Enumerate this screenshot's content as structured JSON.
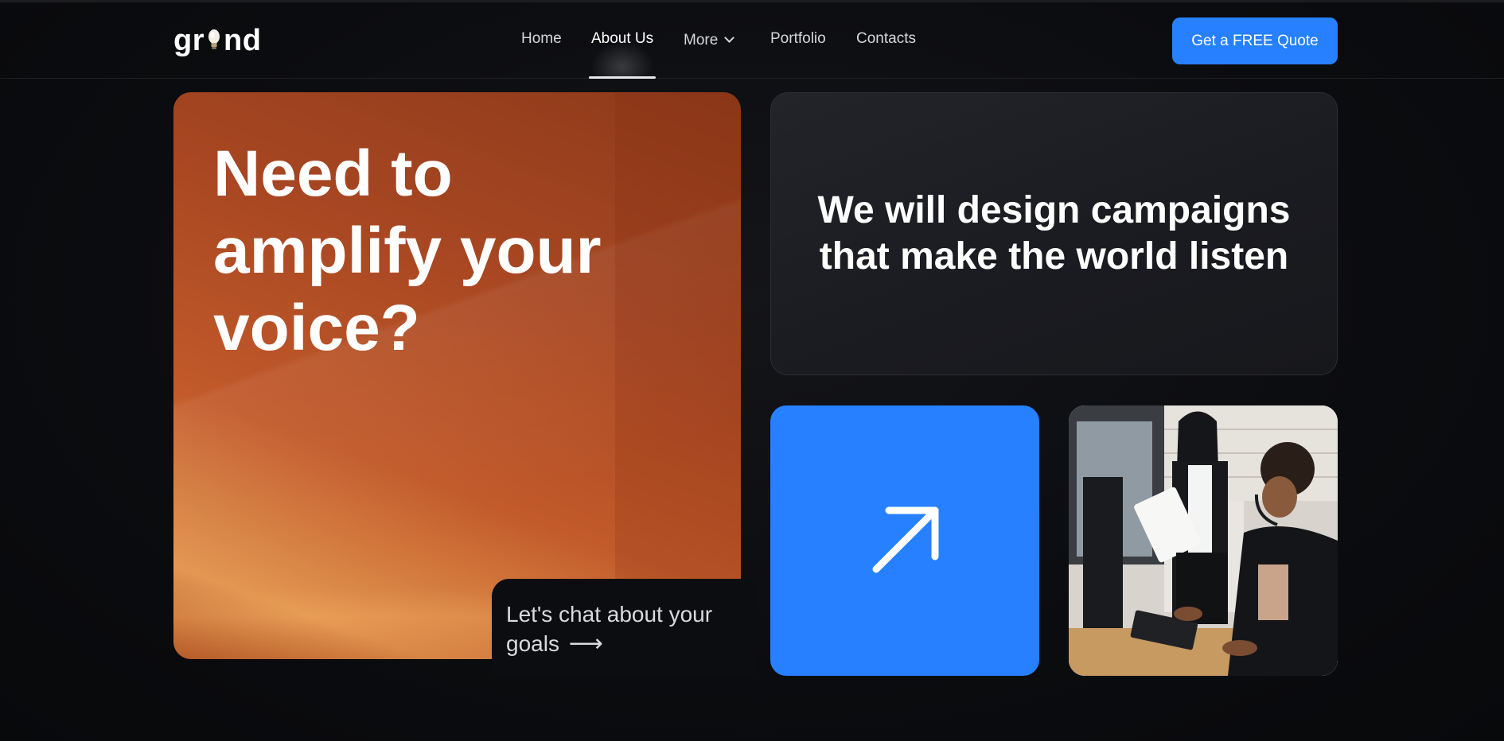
{
  "logo": {
    "text_before": "gr",
    "text_after": "nd",
    "icon": "lightbulb-icon"
  },
  "nav": {
    "items": [
      {
        "label": "Home"
      },
      {
        "label": "About Us",
        "active": true
      },
      {
        "label": "More",
        "has_dropdown": true
      },
      {
        "label": "Portfolio"
      },
      {
        "label": "Contacts"
      }
    ]
  },
  "cta": {
    "label": "Get a FREE Quote"
  },
  "hero": {
    "title": "Need to amplify your voice?",
    "link_label": "Let's chat about your goals",
    "link_arrow": "⟶"
  },
  "statement": {
    "text": "We will design campaigns that make the world listen"
  },
  "arrow_card": {
    "icon": "arrow-up-right-icon"
  },
  "photo": {
    "subject": "two-women-headsets-photo"
  },
  "colors": {
    "accent": "#2680ff",
    "background": "#0b0c0f",
    "hero_orange": "#c25a2a",
    "card_dark": "#1d1f24"
  }
}
